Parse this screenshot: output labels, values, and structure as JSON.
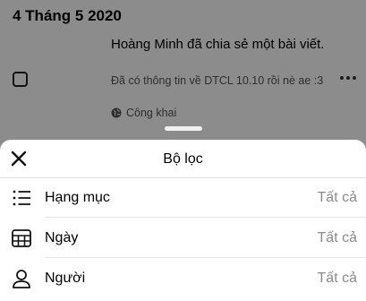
{
  "feed": {
    "date": "4 Tháng 5 2020",
    "post": {
      "title": "Hoàng Minh đã chia sẻ một bài viết.",
      "subtitle": "Đã có thông tin về DTCL 10.10 rồi nè ae :3",
      "privacy": "Công khai"
    }
  },
  "sheet": {
    "title": "Bộ lọc",
    "rows": [
      {
        "label": "Hạng mục",
        "value": "Tất cả",
        "icon": "list-icon"
      },
      {
        "label": "Ngày",
        "value": "Tất cả",
        "icon": "calendar-icon"
      },
      {
        "label": "Người",
        "value": "Tất cả",
        "icon": "person-icon"
      }
    ]
  },
  "colors": {
    "overlay": "#000000",
    "secondary_text": "#8a8a8a"
  }
}
